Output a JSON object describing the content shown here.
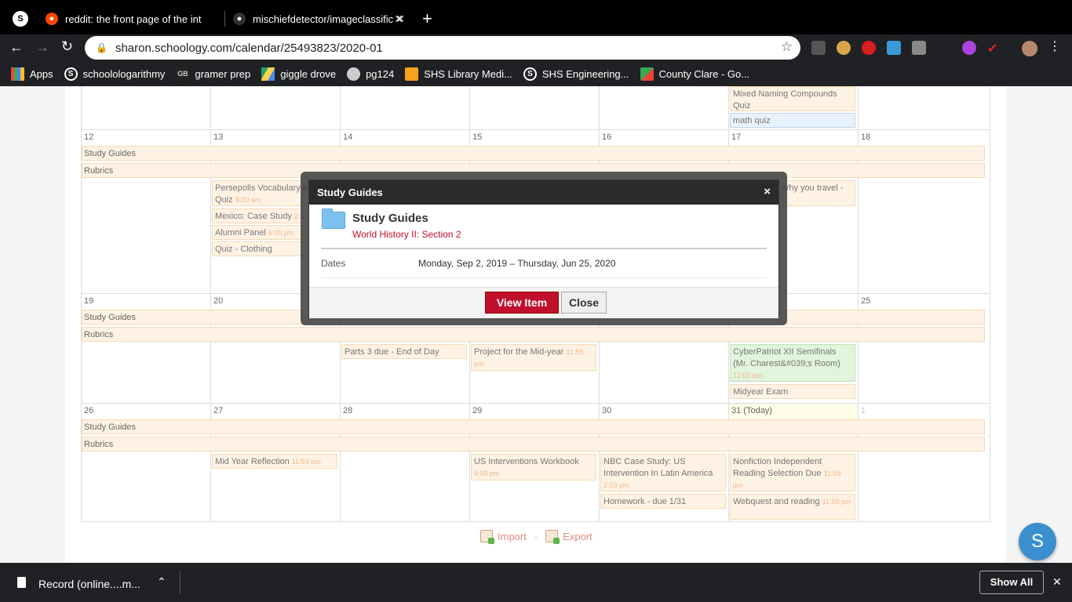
{
  "browser": {
    "tabs": [
      {
        "title": "",
        "favicon": "schoology-icon",
        "active": true
      },
      {
        "title": "reddit: the front page of the int",
        "favicon": "reddit-icon"
      },
      {
        "title": "mischiefdetector/imageclassific",
        "favicon": "github-icon"
      }
    ],
    "new_tab": "+",
    "url": "sharon.schoology.com/calendar/25493823/2020-01",
    "bookmarks": [
      {
        "label": "Apps",
        "icon": "apps-grid-icon"
      },
      {
        "label": "schoolologarithmy",
        "icon": "schoology-icon"
      },
      {
        "label": "gramer prep",
        "icon": "gb-icon"
      },
      {
        "label": "giggle drove",
        "icon": "drive-icon"
      },
      {
        "label": "pg124",
        "icon": "globe-icon"
      },
      {
        "label": "SHS Library Medi...",
        "icon": "library-icon"
      },
      {
        "label": "SHS Engineering...",
        "icon": "schoology-icon"
      },
      {
        "label": "County Clare - Go...",
        "icon": "maps-icon"
      }
    ]
  },
  "calendar": {
    "span_items": [
      "Study Guides",
      "Rubrics"
    ],
    "week1": {
      "days": [
        "12",
        "13",
        "14",
        "15",
        "16",
        "17",
        "18"
      ],
      "events_13": [
        {
          "title": "Persepolis Vocabulary Action Quiz",
          "time": "8:00 am"
        },
        {
          "title": "Mexico: Case Study",
          "time": "2:59"
        },
        {
          "title": "Alumni Panel",
          "time": "6:00 pm"
        },
        {
          "title": "Quiz - Clothing",
          "time": ""
        }
      ],
      "events_17": [
        {
          "title": "Why you travel -",
          "time": ""
        }
      ]
    },
    "prev_week": [
      {
        "title": "Mixed Naming Compounds Quiz"
      },
      {
        "title": "math quiz"
      }
    ],
    "week2": {
      "days": [
        "19",
        "20",
        "25"
      ],
      "events": [
        {
          "title": "Parts 3 due - End of Day",
          "time": ""
        },
        {
          "title": "Project for the Mid-year",
          "time": "11:59 pm"
        },
        {
          "title": "CyberPatriot XII Semifinals (Mr. Charest&#039;s Room)",
          "time": "12:00 pm"
        },
        {
          "title": "Midyear Exam",
          "time": ""
        }
      ]
    },
    "week3": {
      "days": [
        "26",
        "27",
        "28",
        "29",
        "30",
        "31 (Today)",
        "1"
      ],
      "events": [
        {
          "title": "Mid Year Reflection",
          "time": "11:59 pm"
        },
        {
          "title": "US Interventions Workbook",
          "time": "4:59 pm"
        },
        {
          "title": "NBC Case Study: US Intervention In Latin America",
          "time": "2:59 pm"
        },
        {
          "title": "Homework - due 1/31",
          "time": ""
        },
        {
          "title": "Nonfiction Independent Reading Selection Due",
          "time": "11:59 pm"
        },
        {
          "title": "Webquest and reading",
          "time": "11:59 pm"
        }
      ]
    },
    "import_label": "Import",
    "separator": "·",
    "export_label": "Export"
  },
  "modal": {
    "header": "Study Guides",
    "close_glyph": "×",
    "title": "Study Guides",
    "course": "World History II: Section 2",
    "dates_label": "Dates",
    "dates_value": "Monday, Sep 2, 2019 – Thursday, Jun 25, 2020",
    "view_button": "View Item",
    "close_button": "Close"
  },
  "fab": "S",
  "downloads": {
    "file": "Record (online....m...",
    "show_all": "Show All",
    "close_glyph": "✕"
  },
  "colors": {
    "accent": "#c0102c",
    "event_bg": "#fef2e4",
    "fab": "#3b8fcf"
  }
}
